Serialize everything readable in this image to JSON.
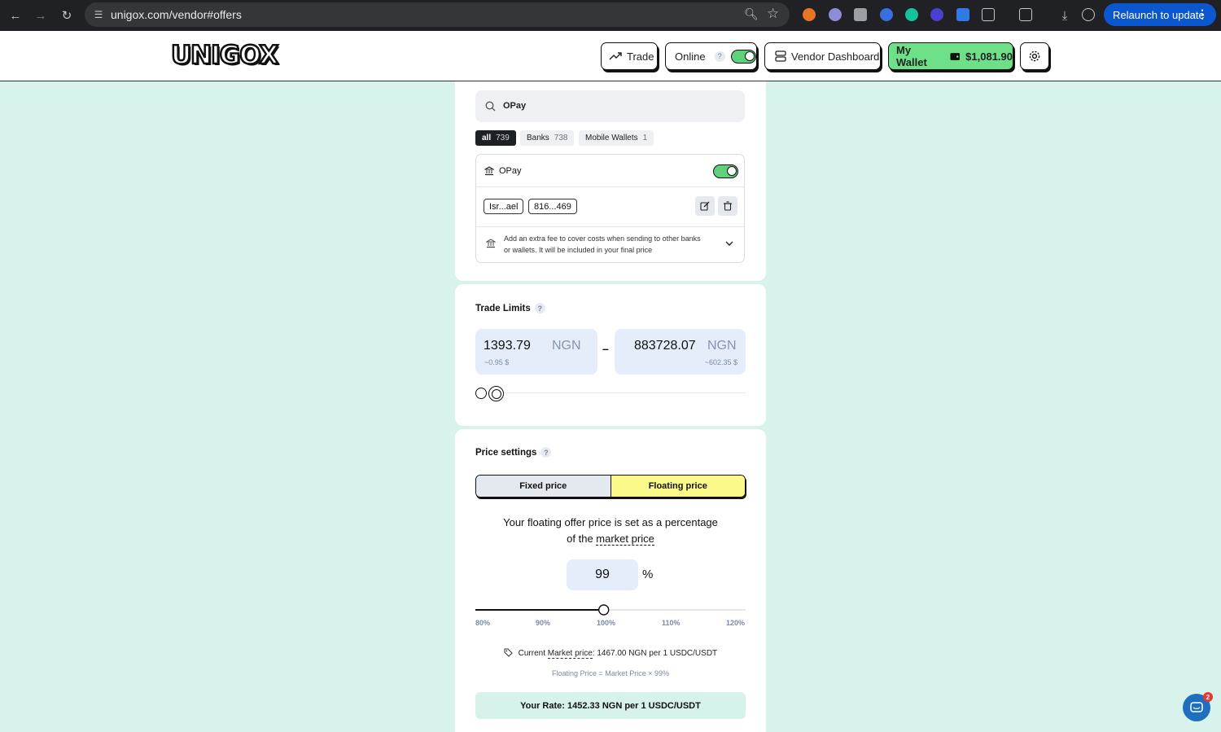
{
  "browser": {
    "url": "unigox.com/vendor#offers",
    "relaunch_label": "Relaunch to update"
  },
  "header": {
    "logo": "UNIGOX",
    "trade_label": "Trade",
    "online_label": "Online",
    "vendor_dashboard_label": "Vendor Dashboard",
    "wallet_label": "My Wallet",
    "wallet_balance": "$1,081.90"
  },
  "payment_methods": {
    "search_value": "OPay",
    "filters": [
      {
        "label": "all",
        "count": "739",
        "active": true
      },
      {
        "label": "Banks",
        "count": "738",
        "active": false
      },
      {
        "label": "Mobile Wallets",
        "count": "1",
        "active": false
      }
    ],
    "method_name": "OPay",
    "method_enabled": true,
    "account_chips": [
      "Isr...ael",
      "816...469"
    ],
    "extra_fee_text_line1": "Add an extra fee to cover costs when sending to other banks",
    "extra_fee_text_line2": "or wallets. It will be included in your final price"
  },
  "trade_limits": {
    "title": "Trade Limits",
    "help": "?",
    "min_amount": "1393.79",
    "min_currency": "NGN",
    "min_usd": "~0.95 $",
    "separator": "–",
    "max_amount": "883728.07",
    "max_currency": "NGN",
    "max_usd": "~602.35 $"
  },
  "price_settings": {
    "title": "Price settings",
    "help": "?",
    "tab_fixed": "Fixed price",
    "tab_floating": "Floating price",
    "description_prefix": "Your floating offer price is set as a percentage",
    "description_mid": "of the ",
    "description_link": "market price",
    "percentage_value": "99",
    "percent_sign": "%",
    "slider_percent": 99,
    "ticks": [
      "80%",
      "90%",
      "100%",
      "110%",
      "120%"
    ],
    "current_market_label": "Current ",
    "current_market_link": "Market price",
    "current_market_value": ": 1467.00 NGN per 1 USDC/USDT",
    "formula": "Floating Price = Market Price × 99%",
    "your_rate": "Your Rate: 1452.33 NGN per 1 USDC/USDT"
  },
  "chat": {
    "badge_count": "2"
  },
  "colors": {
    "page_bg": "#d8f3ec",
    "accent_green": "#6fe08a",
    "accent_yellow": "#fbf98a",
    "input_blue": "#e5edfb"
  }
}
